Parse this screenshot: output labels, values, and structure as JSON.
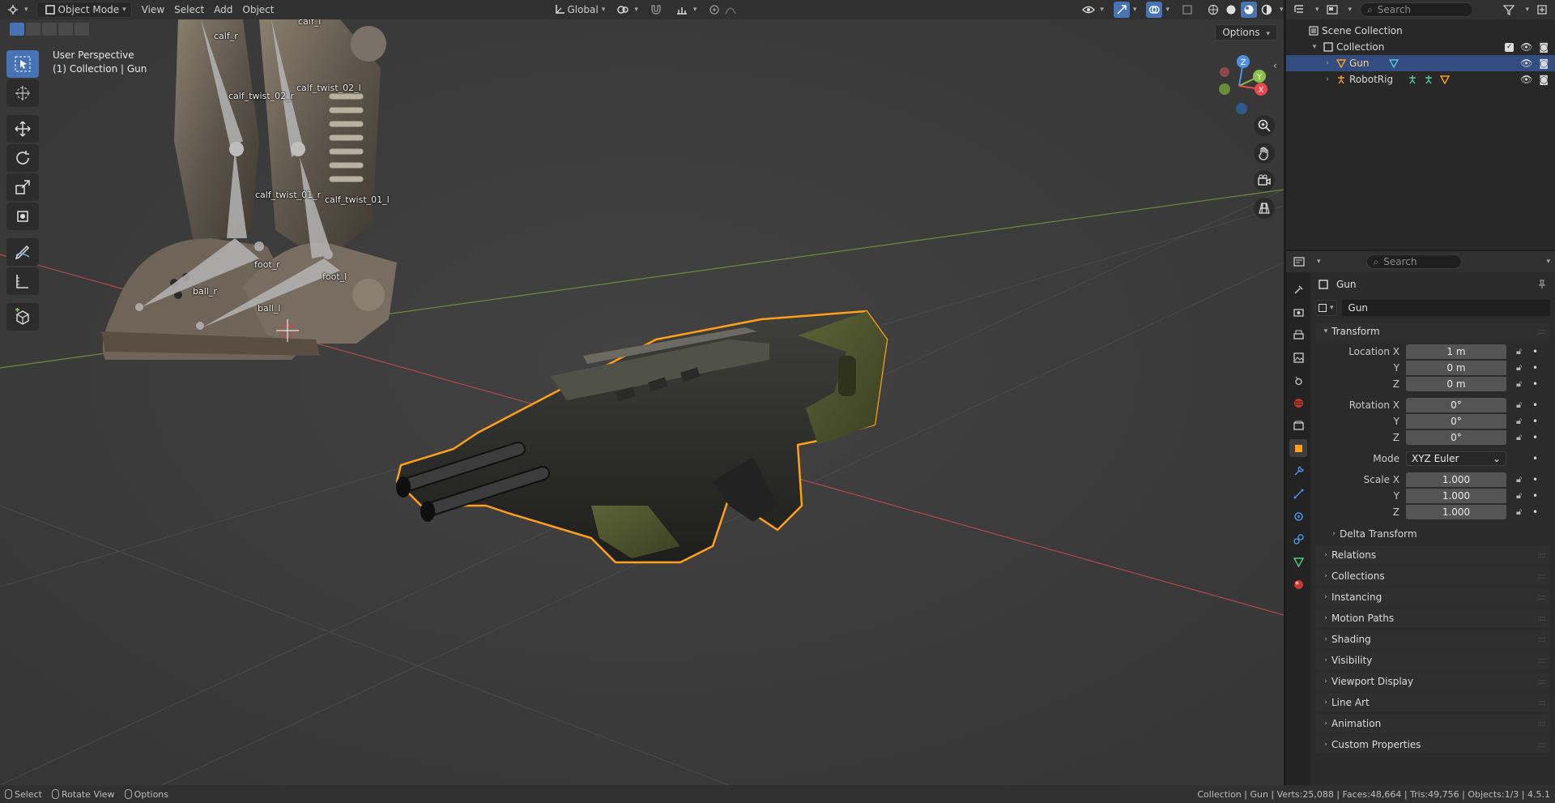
{
  "header": {
    "mode": "Object Mode",
    "menus": [
      "View",
      "Select",
      "Add",
      "Object"
    ],
    "orientation": "Global"
  },
  "viewport": {
    "perspective": "User Perspective",
    "collection_info": "(1) Collection | Gun",
    "options_label": "Options",
    "bones": [
      "calf_r",
      "calf_l",
      "calf_twist_02_r",
      "calf_twist_02_l",
      "calf_twist_01_r",
      "calf_twist_01_l",
      "foot_r",
      "foot_l",
      "ball_r",
      "ball_l"
    ],
    "gizmo_axes": [
      "Z",
      "Y",
      "X"
    ]
  },
  "outliner": {
    "search_placeholder": "Search",
    "scene_collection": "Scene Collection",
    "collection": "Collection",
    "items": [
      "Gun",
      "RobotRig"
    ]
  },
  "properties": {
    "search_placeholder": "Search",
    "object_name": "Gun",
    "data_name": "Gun",
    "transform_label": "Transform",
    "location_label": "Location X",
    "location": [
      "1 m",
      "0 m",
      "0 m"
    ],
    "rotation_label": "Rotation X",
    "rotation": [
      "0°",
      "0°",
      "0°"
    ],
    "mode_label": "Mode",
    "mode_value": "XYZ Euler",
    "scale_label": "Scale X",
    "scale": [
      "1.000",
      "1.000",
      "1.000"
    ],
    "axis_y": "Y",
    "axis_z": "Z",
    "delta_transform": "Delta Transform",
    "panels": [
      "Relations",
      "Collections",
      "Instancing",
      "Motion Paths",
      "Shading",
      "Visibility",
      "Viewport Display",
      "Line Art",
      "Animation",
      "Custom Properties"
    ]
  },
  "status": {
    "select": "Select",
    "rotate": "Rotate View",
    "options": "Options",
    "stats": "Collection | Gun | Verts:25,088 | Faces:48,664 | Tris:49,756 | Objects:1/3 | 4.5.1"
  },
  "colors": {
    "selection_outline": "#ff9f1a",
    "active_blue": "#4772b3",
    "x_axis": "#e8484f",
    "y_axis": "#8bc34a",
    "z_axis": "#4f8fe6"
  }
}
